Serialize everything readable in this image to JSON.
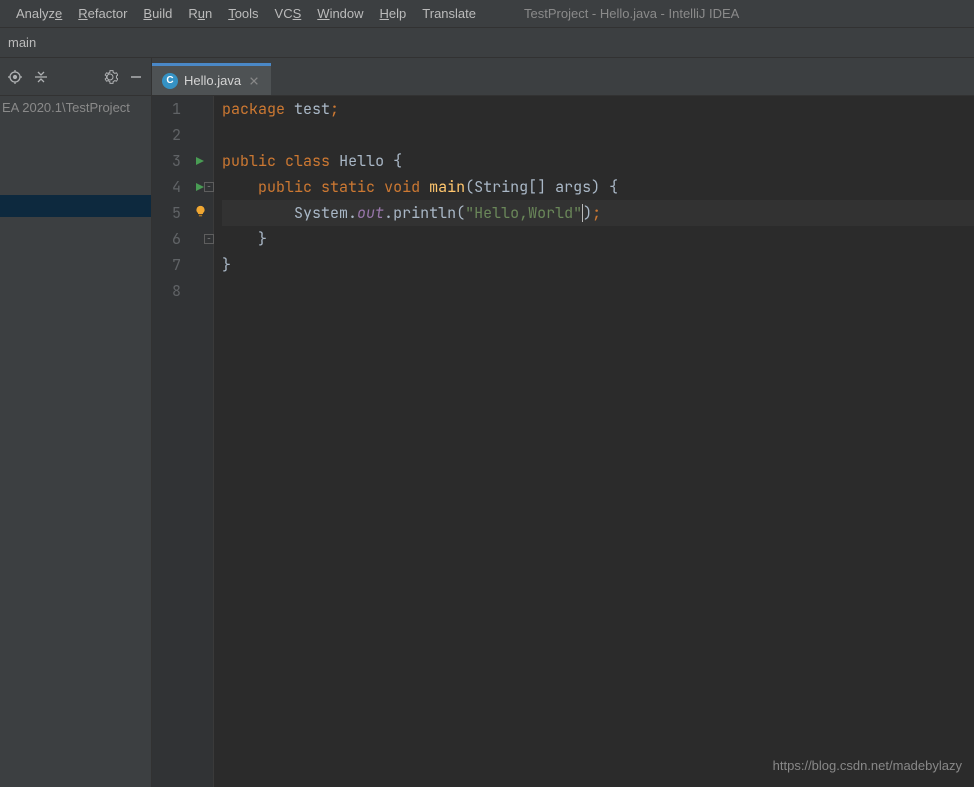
{
  "menu": {
    "items": [
      {
        "pre": "Analyz",
        "u": "e",
        "post": ""
      },
      {
        "pre": "",
        "u": "R",
        "post": "efactor"
      },
      {
        "pre": "",
        "u": "B",
        "post": "uild"
      },
      {
        "pre": "R",
        "u": "u",
        "post": "n"
      },
      {
        "pre": "",
        "u": "T",
        "post": "ools"
      },
      {
        "pre": "VC",
        "u": "S",
        "post": ""
      },
      {
        "pre": "",
        "u": "W",
        "post": "indow"
      },
      {
        "pre": "",
        "u": "H",
        "post": "elp"
      },
      {
        "pre": "Translate",
        "u": "",
        "post": ""
      }
    ],
    "window_title": "TestProject - Hello.java - IntelliJ IDEA"
  },
  "nav": {
    "breadcrumb": "main"
  },
  "sidebar": {
    "tree_text": "EA 2020.1\\TestProject"
  },
  "tab": {
    "label": "Hello.java",
    "icon_letter": "C"
  },
  "gutter": {
    "lines": [
      "1",
      "2",
      "3",
      "4",
      "5",
      "6",
      "7",
      "8"
    ]
  },
  "code": {
    "l1": {
      "kw": "package",
      "sp": " ",
      "name": "test",
      "semi": ";"
    },
    "l3": {
      "kw1": "public",
      "sp1": " ",
      "kw2": "class",
      "sp2": " ",
      "cls": "Hello",
      "rest": " {"
    },
    "l4": {
      "indent": "    ",
      "kw1": "public",
      "sp1": " ",
      "kw2": "static",
      "sp2": " ",
      "kw3": "void",
      "sp3": " ",
      "mtd": "main",
      "paren": "(String[] args) {"
    },
    "l5": {
      "indent": "        ",
      "sys": "System.",
      "out": "out",
      "dot": ".",
      "prn": "println",
      "open": "(",
      "str": "\"Hello,World\"",
      "close": ")",
      "semi": ";"
    },
    "l6": {
      "indent": "    ",
      "brace": "}"
    },
    "l7": {
      "brace": "}"
    }
  },
  "watermark": "https://blog.csdn.net/madebylazy"
}
